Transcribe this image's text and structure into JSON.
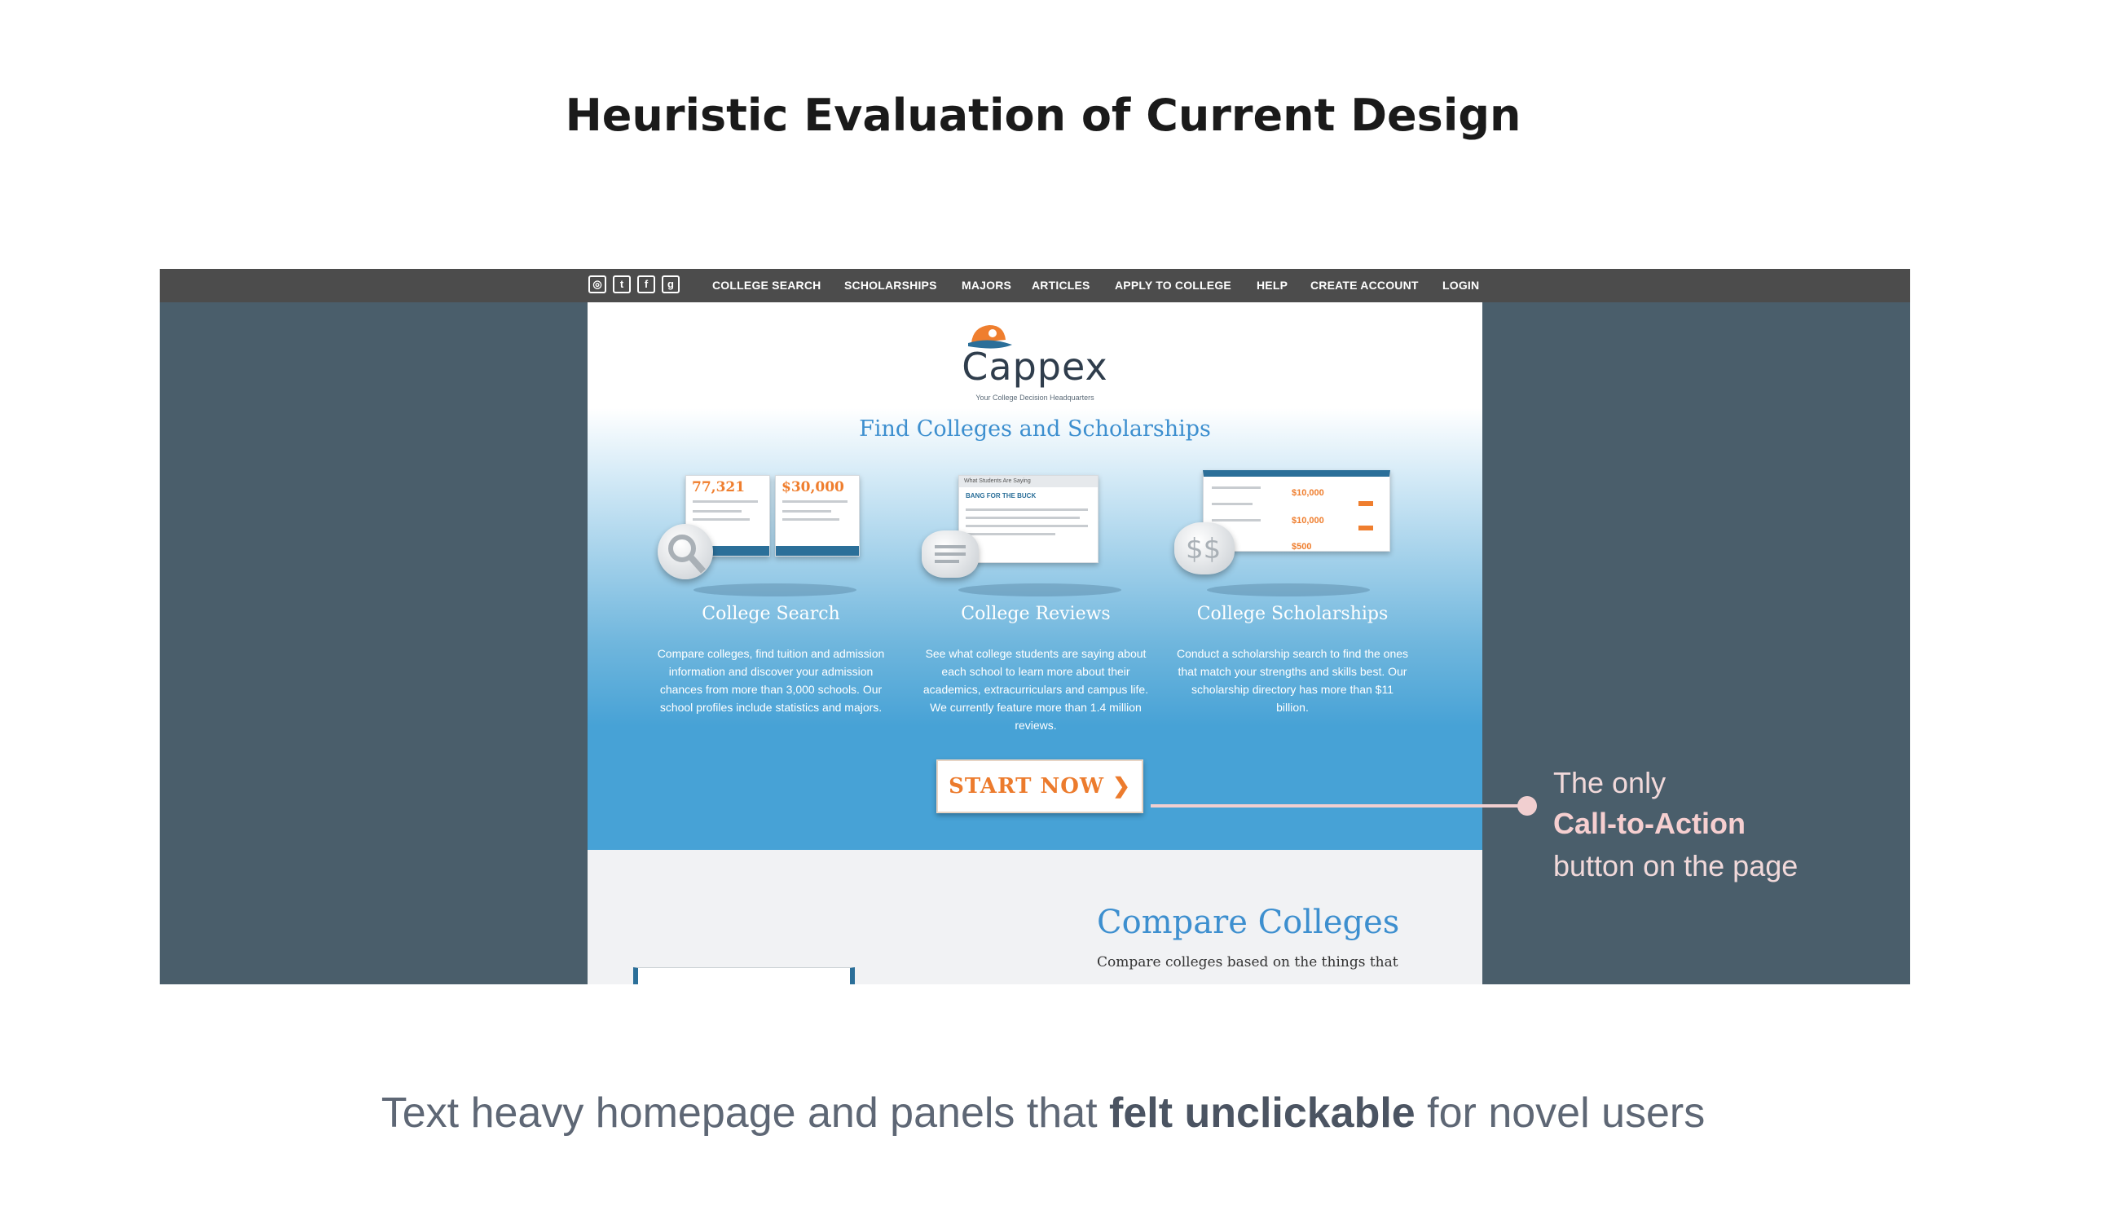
{
  "slide": {
    "title": "Heuristic Evaluation of Current Design",
    "caption_before": "Text heavy homepage and panels that ",
    "caption_bold": "felt unclickable",
    "caption_after": " for novel users"
  },
  "site": {
    "social_icons": [
      "instagram-icon",
      "twitter-icon",
      "facebook-icon",
      "google-plus-icon"
    ],
    "nav": [
      "COLLEGE SEARCH",
      "SCHOLARSHIPS",
      "MAJORS",
      "ARTICLES",
      "APPLY TO COLLEGE",
      "HELP",
      "CREATE ACCOUNT",
      "LOGIN"
    ],
    "logo": "Cappex",
    "tagline": "Your College Decision Headquarters",
    "hero_title": "Find Colleges and Scholarships",
    "stat1": "77,321",
    "stat2": "$30,000",
    "reviews_card_header": "What Students Are Saying",
    "reviews_card_title": "BANG FOR THE BUCK",
    "scholarship_amounts": [
      "$10,000",
      "$10,000",
      "$500"
    ],
    "features": [
      {
        "title": "College Search",
        "desc": "Compare colleges, find tuition and admission information and discover your admission chances from more than 3,000 schools. Our school profiles include statistics and majors."
      },
      {
        "title": "College Reviews",
        "desc": "See what college students are saying about each school to learn more about their academics, extracurriculars and campus life. We currently feature more than 1.4 million reviews."
      },
      {
        "title": "College Scholarships",
        "desc": "Conduct a scholarship search to find the ones that match your strengths and skills best. Our scholarship directory has more than $11 billion."
      }
    ],
    "cta": "START NOW ❯",
    "compare_title": "Compare Colleges",
    "compare_desc": "Compare colleges based on the things that"
  },
  "annotation": {
    "line1": "The only",
    "line2": "Call-to-Action",
    "line3": "button on the page"
  },
  "colors": {
    "frame": "#4a5e6b",
    "topbar": "#4c4c4c",
    "hero_blue": "#47a2d6",
    "brand_orange": "#ec7b2d",
    "annotation_pink": "#f1cfd0"
  }
}
